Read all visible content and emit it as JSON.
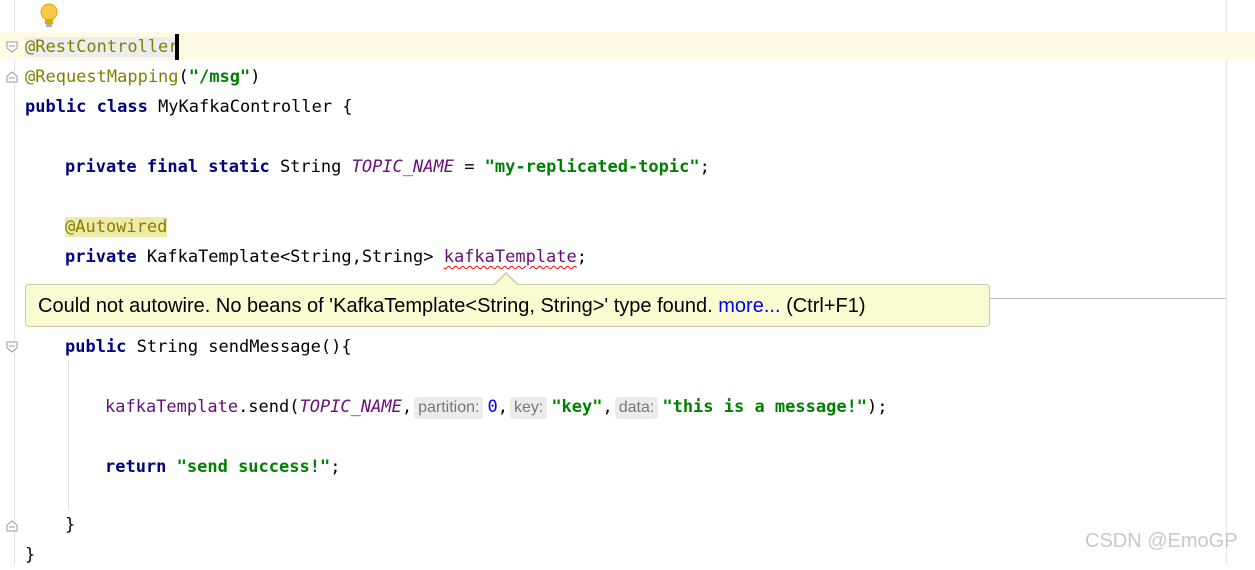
{
  "editor": {
    "lines": {
      "l1": {
        "ann": "@RestController"
      },
      "l2": {
        "ann": "@RequestMapping",
        "open": "(",
        "str": "\"/msg\"",
        "close": ")"
      },
      "l3": {
        "kw": "public class",
        "name": " MyKafkaController {"
      },
      "l5": {
        "kw": "private final static",
        "type": " String ",
        "const": "TOPIC_NAME",
        "eq": " = ",
        "str": "\"my-replicated-topic\"",
        "end": ";"
      },
      "l7": {
        "ann": "@Autowired"
      },
      "l8": {
        "kw": "private",
        "type": " KafkaTemplate<String,String> ",
        "field": "kafkaTemplate",
        "end": ";"
      },
      "l11": {
        "kw": "public",
        "rest": " String sendMessage(){"
      },
      "l13": {
        "field": "kafkaTemplate",
        "call": ".send(",
        "const": "TOPIC_NAME",
        "comma1": ",",
        "hint_partition": "partition:",
        "num": "0",
        "comma2": ",",
        "hint_key": "key:",
        "str_key": "\"key\"",
        "comma3": ",",
        "hint_data": "data:",
        "str_data": "\"this is a message!\"",
        "end": ");"
      },
      "l15": {
        "kw": "return",
        "str": " \"send success!\"",
        "end": ";"
      },
      "l17": {
        "brace": "}"
      },
      "l18": {
        "brace": "}"
      }
    }
  },
  "tooltip": {
    "message": "Could not autowire. No beans of 'KafkaTemplate<String, String>' type found. ",
    "link": "more...",
    "shortcut": " (Ctrl+F1)"
  },
  "icons": {
    "bulb": "lightbulb-icon",
    "fold": "fold-marker-icon"
  },
  "watermark": "CSDN @EmoGP"
}
